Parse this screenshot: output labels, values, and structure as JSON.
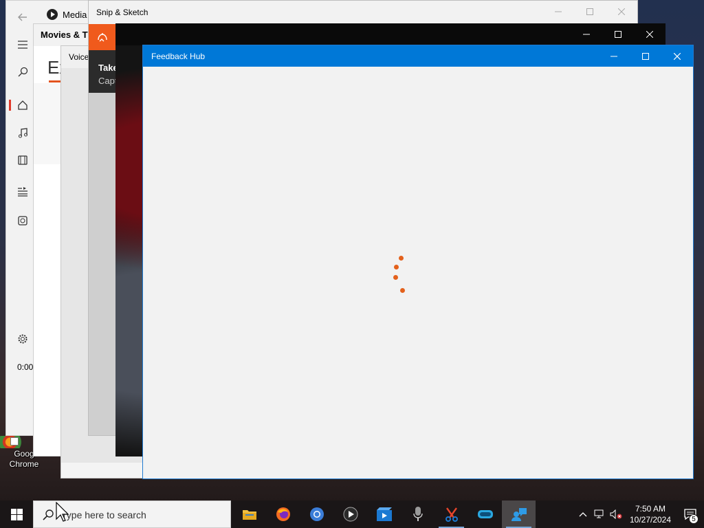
{
  "desktop": {
    "chrome_shortcut_label": "Goog \nChrome",
    "label_line1": "Goog",
    "label_line2": "Chrome"
  },
  "media_window": {
    "title": "Media",
    "time": "0:00:"
  },
  "movies_window": {
    "title": "Movies & TV",
    "heading_fragment": "Ex"
  },
  "voice_window": {
    "title": "Voice"
  },
  "snip_window": {
    "title": "Snip & Sketch",
    "tooltip_title": "Take",
    "tooltip_sub": "Capt"
  },
  "feedback_window": {
    "title": "Feedback Hub"
  },
  "taskbar": {
    "search_placeholder": "Type here to search",
    "pinned": [
      "file-explorer",
      "firefox",
      "chromium",
      "media-player",
      "movies-and-tv",
      "voice-recorder",
      "snip-and-sketch",
      "mixed-reality-portal",
      "feedback-hub"
    ],
    "active": "feedback-hub"
  },
  "tray": {
    "time": "7:50 AM",
    "date": "10/27/2024",
    "notification_count": "5"
  },
  "colors": {
    "accent": "#0078d7",
    "snip_orange": "#f05a1c",
    "spinner": "#e3611c"
  }
}
